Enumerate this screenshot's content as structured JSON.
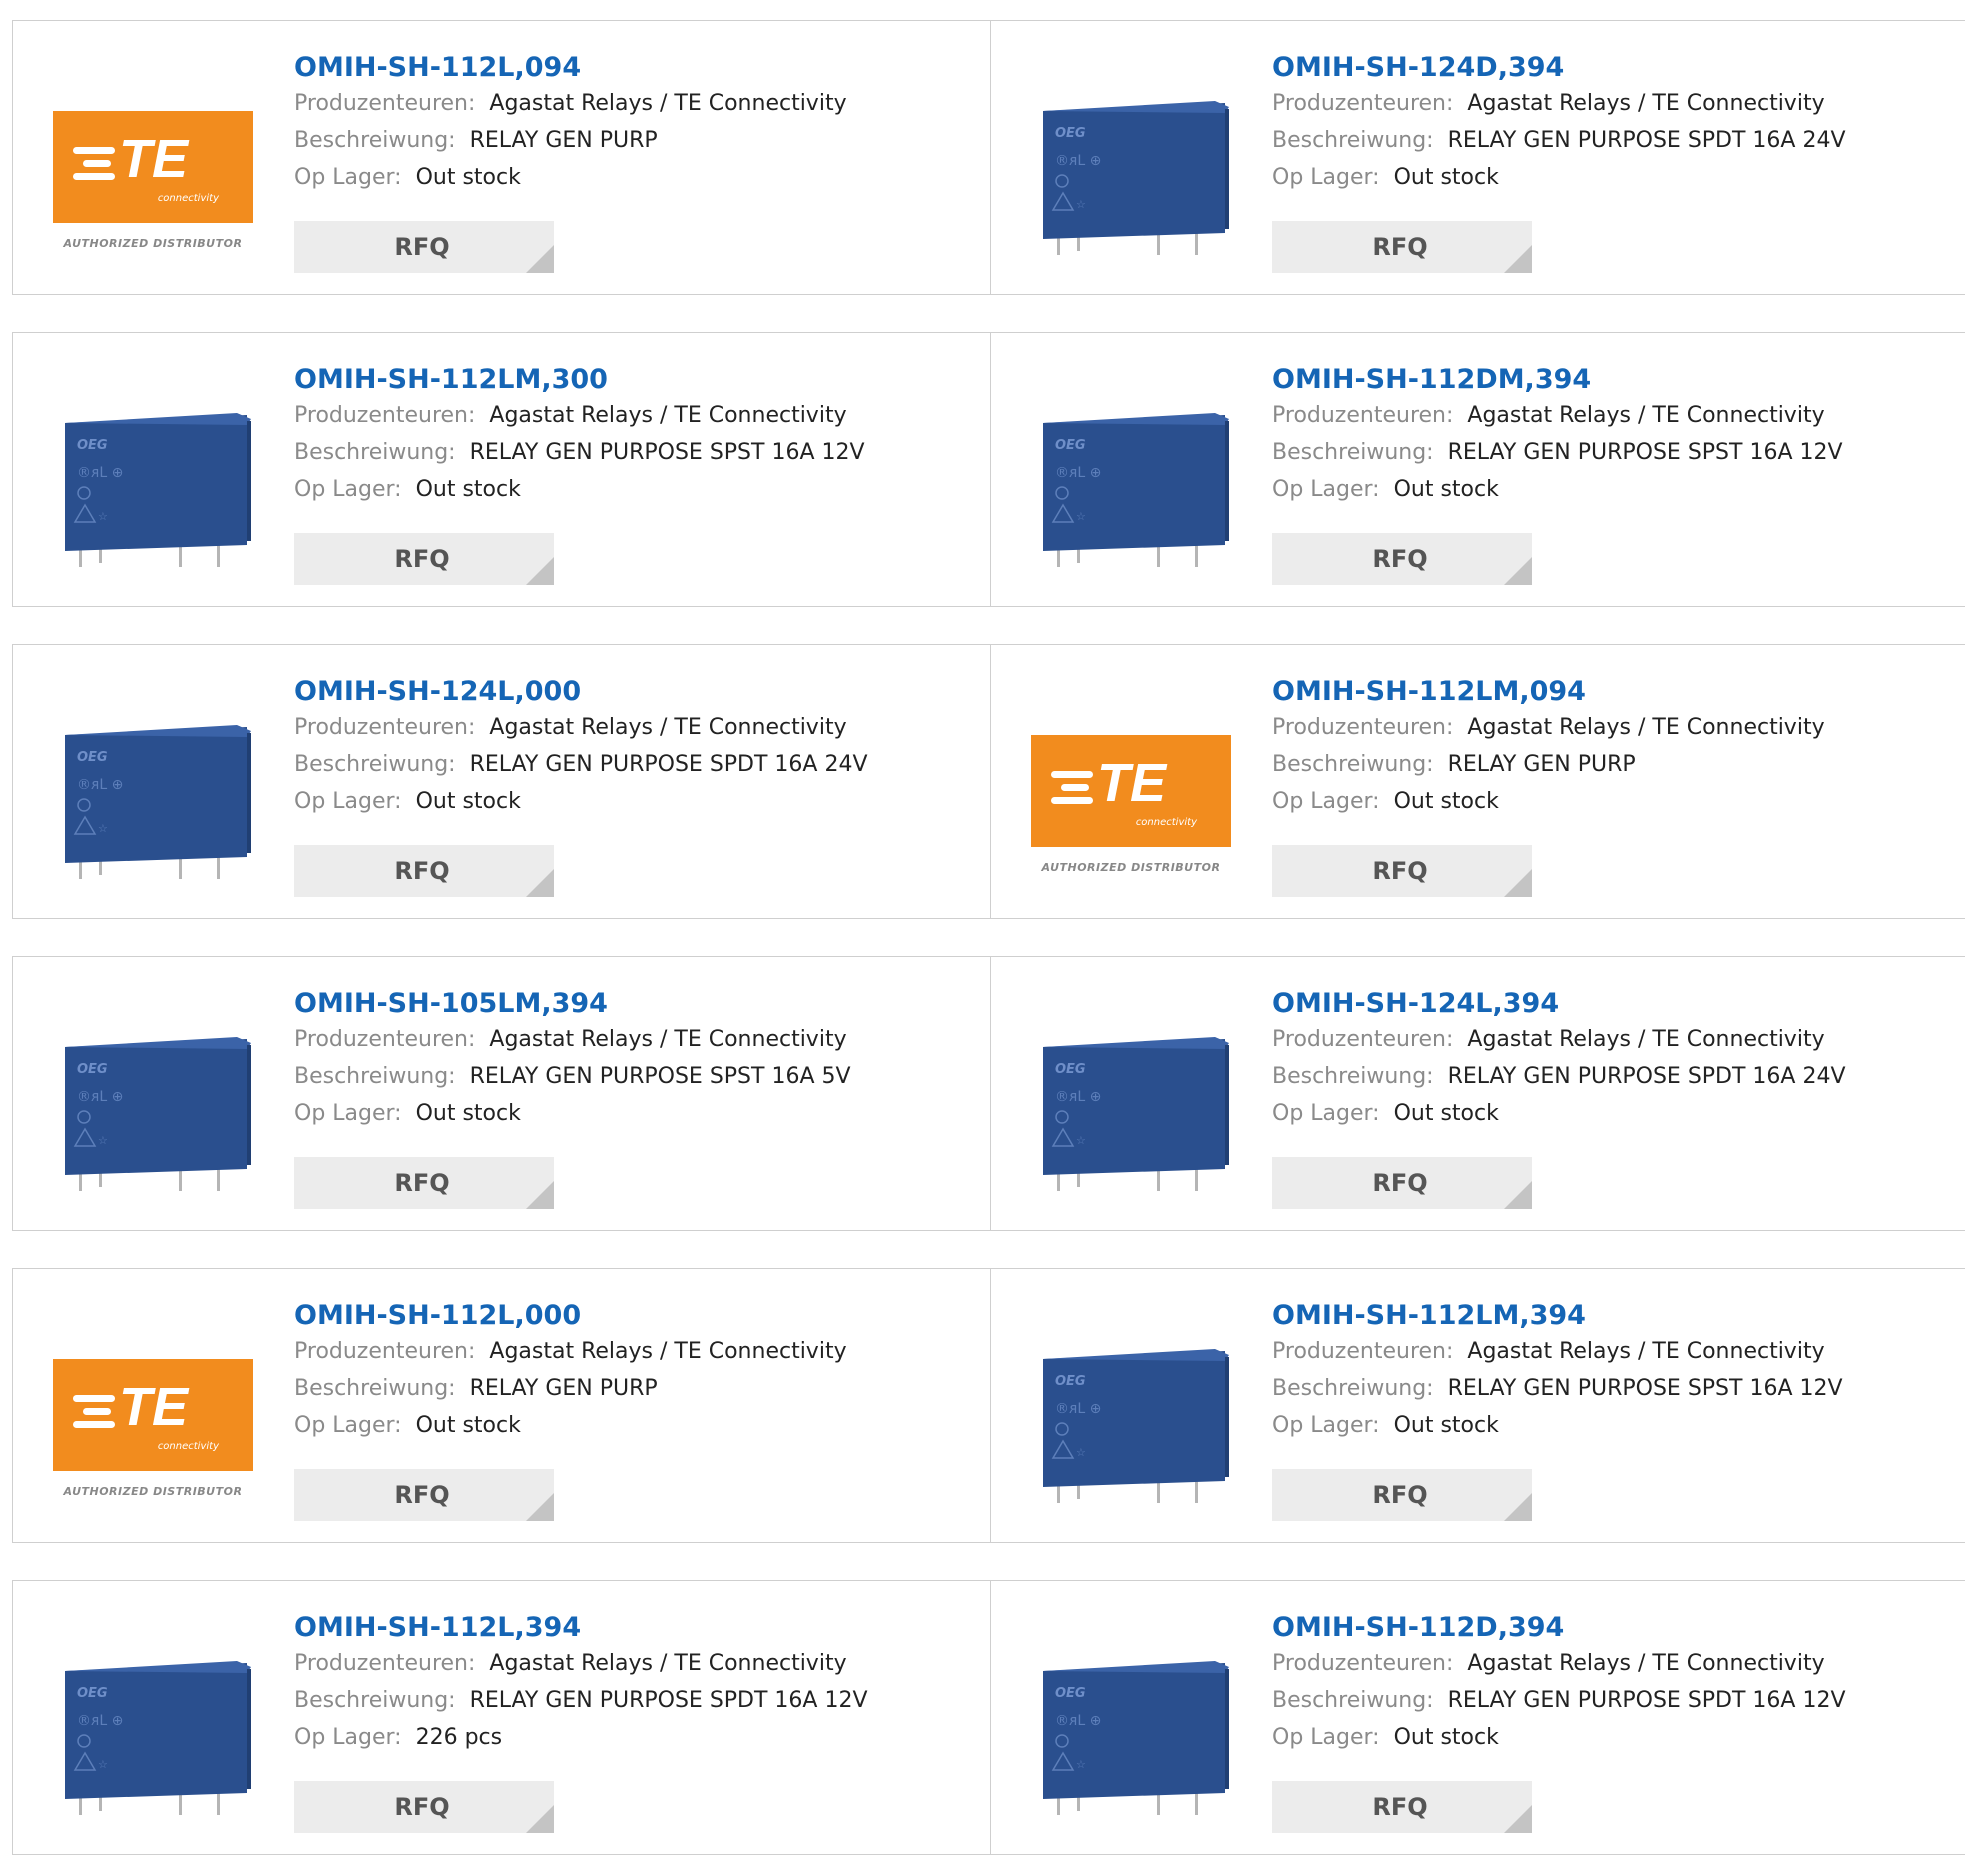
{
  "labels": {
    "manufacturer": "Produzenteuren:",
    "description": "Beschreiwung:",
    "stock": "Op Lager:",
    "rfq": "RFQ"
  },
  "logo": {
    "brand": "TE",
    "tagline": "connectivity",
    "badge": "AUTHORIZED DISTRIBUTOR",
    "color": "#f28c1e"
  },
  "colors": {
    "link": "#1565b5",
    "relay_body": "#2a4f8e",
    "button_bg": "#ececec"
  },
  "products": [
    {
      "part": "OMIH-SH-112L,094",
      "manufacturer": "Agastat Relays / TE Connectivity",
      "description": "RELAY GEN PURP",
      "stock": "Out stock",
      "image": "te-logo"
    },
    {
      "part": "OMIH-SH-124D,394",
      "manufacturer": "Agastat Relays / TE Connectivity",
      "description": "RELAY GEN PURPOSE SPDT 16A 24V",
      "stock": "Out stock",
      "image": "relay"
    },
    {
      "part": "OMIH-SH-112LM,300",
      "manufacturer": "Agastat Relays / TE Connectivity",
      "description": "RELAY GEN PURPOSE SPST 16A 12V",
      "stock": "Out stock",
      "image": "relay"
    },
    {
      "part": "OMIH-SH-112DM,394",
      "manufacturer": "Agastat Relays / TE Connectivity",
      "description": "RELAY GEN PURPOSE SPST 16A 12V",
      "stock": "Out stock",
      "image": "relay"
    },
    {
      "part": "OMIH-SH-124L,000",
      "manufacturer": "Agastat Relays / TE Connectivity",
      "description": "RELAY GEN PURPOSE SPDT 16A 24V",
      "stock": "Out stock",
      "image": "relay"
    },
    {
      "part": "OMIH-SH-112LM,094",
      "manufacturer": "Agastat Relays / TE Connectivity",
      "description": "RELAY GEN PURP",
      "stock": "Out stock",
      "image": "te-logo"
    },
    {
      "part": "OMIH-SH-105LM,394",
      "manufacturer": "Agastat Relays / TE Connectivity",
      "description": "RELAY GEN PURPOSE SPST 16A 5V",
      "stock": "Out stock",
      "image": "relay"
    },
    {
      "part": "OMIH-SH-124L,394",
      "manufacturer": "Agastat Relays / TE Connectivity",
      "description": "RELAY GEN PURPOSE SPDT 16A 24V",
      "stock": "Out stock",
      "image": "relay"
    },
    {
      "part": "OMIH-SH-112L,000",
      "manufacturer": "Agastat Relays / TE Connectivity",
      "description": "RELAY GEN PURP",
      "stock": "Out stock",
      "image": "te-logo"
    },
    {
      "part": "OMIH-SH-112LM,394",
      "manufacturer": "Agastat Relays / TE Connectivity",
      "description": "RELAY GEN PURPOSE SPST 16A 12V",
      "stock": "Out stock",
      "image": "relay"
    },
    {
      "part": "OMIH-SH-112L,394",
      "manufacturer": "Agastat Relays / TE Connectivity",
      "description": "RELAY GEN PURPOSE SPDT 16A 12V",
      "stock": "226 pcs",
      "image": "relay"
    },
    {
      "part": "OMIH-SH-112D,394",
      "manufacturer": "Agastat Relays / TE Connectivity",
      "description": "RELAY GEN PURPOSE SPDT 16A 12V",
      "stock": "Out stock",
      "image": "relay"
    }
  ]
}
